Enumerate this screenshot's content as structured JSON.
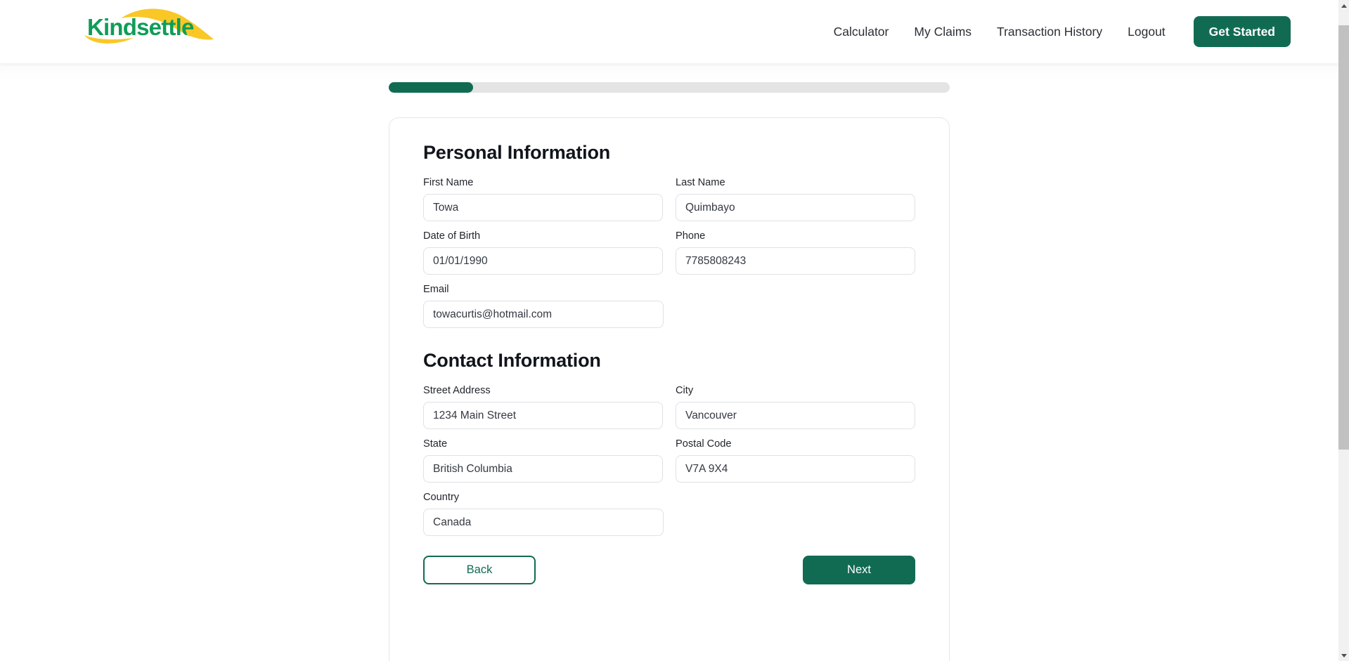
{
  "header": {
    "logo_text": "Kindsettle.",
    "logo_colors": {
      "text": "#0f9d58",
      "swoosh": "#F9C827"
    },
    "nav_items": [
      {
        "label": "Calculator",
        "name": "nav-link-calculator"
      },
      {
        "label": "My Claims",
        "name": "nav-link-my-claims"
      },
      {
        "label": "Transaction History",
        "name": "nav-link-transaction-history"
      },
      {
        "label": "Logout",
        "name": "nav-link-logout"
      }
    ],
    "cta_label": "Get Started",
    "cta_color": "#116B53"
  },
  "progress": {
    "percent": 15,
    "fill_width": "15%",
    "fill_color": "#116B53",
    "track_color": "#e4e4e4"
  },
  "form": {
    "personal_section_title": "Personal Information",
    "contact_section_title": "Contact Information",
    "fields": {
      "first_name": {
        "label": "First Name",
        "value": "Towa"
      },
      "last_name": {
        "label": "Last Name",
        "value": "Quimbayo"
      },
      "date_of_birth": {
        "label": "Date of Birth",
        "value": "01/01/1990"
      },
      "phone": {
        "label": "Phone",
        "value": "7785808243"
      },
      "email": {
        "label": "Email",
        "value": "towacurtis@hotmail.com"
      },
      "street_address": {
        "label": "Street Address",
        "value": "1234 Main Street"
      },
      "city": {
        "label": "City",
        "value": "Vancouver"
      },
      "state": {
        "label": "State",
        "value": "British Columbia"
      },
      "postal_code": {
        "label": "Postal Code",
        "value": "V7A 9X4"
      },
      "country": {
        "label": "Country",
        "value": "Canada"
      }
    },
    "back_label": "Back",
    "next_label": "Next"
  },
  "scrollbar": {
    "up_icon": "caret-up-icon",
    "down_icon": "caret-down-icon"
  }
}
